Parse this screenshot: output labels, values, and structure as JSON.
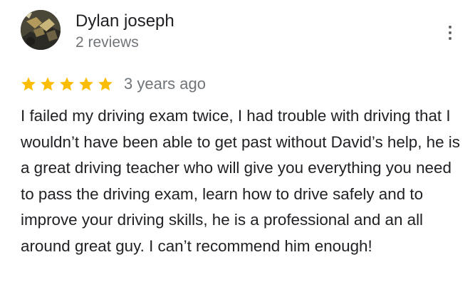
{
  "review": {
    "reviewer_name": "Dylan joseph",
    "review_count": "2 reviews",
    "rating": 5,
    "rating_max": 5,
    "date": "3 years ago",
    "text": "I failed my driving exam twice, I had trouble with driving that I wouldn’t have been able to get past without David’s help, he is a great driving teacher who will give you everything you need to pass the driving exam, learn how to drive safely and to improve your driving skills, he is a professional and an all around great guy. I can’t recommend him enough!"
  },
  "icons": {
    "more": "more-vert-icon",
    "star": "star-icon",
    "avatar": "user-avatar"
  },
  "colors": {
    "star": "#fbbc04",
    "name": "#202124",
    "secondary": "#70757a",
    "icon": "#5f6368"
  }
}
